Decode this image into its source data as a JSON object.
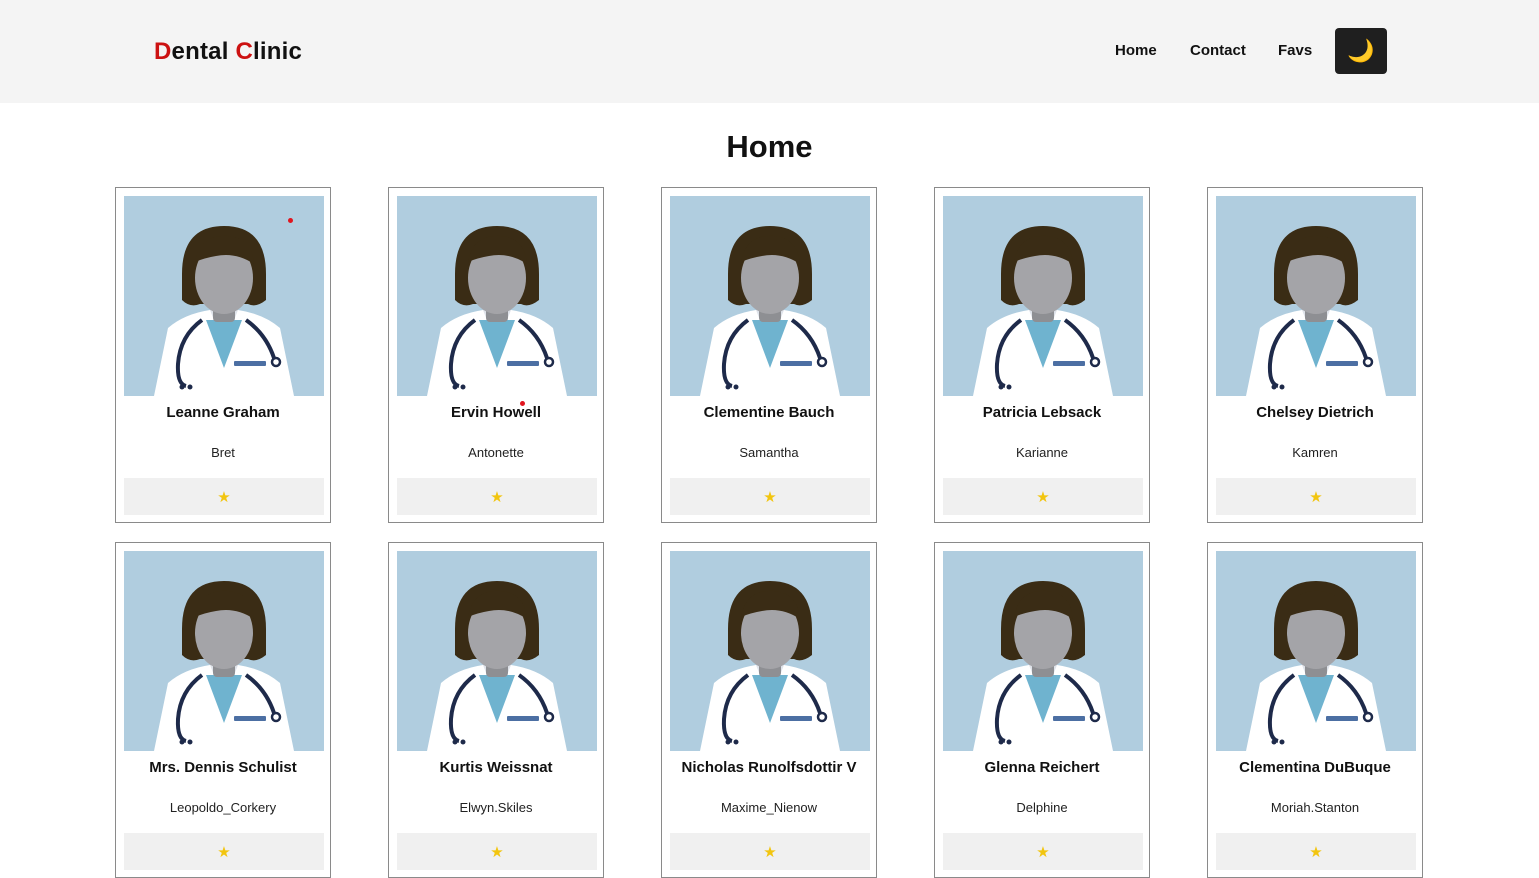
{
  "header": {
    "logo_first_initial": "D",
    "logo_first_rest": "ental ",
    "logo_second_initial": "C",
    "logo_second_rest": "linic",
    "nav": [
      {
        "label": "Home"
      },
      {
        "label": "Contact"
      },
      {
        "label": "Favs"
      }
    ],
    "theme_toggle_icon": "moon-icon",
    "theme_toggle_glyph": "🌙"
  },
  "main": {
    "title": "Home",
    "fav_glyph": "★",
    "fav_icon": "star-icon",
    "cards": [
      {
        "name": "Leanne Graham",
        "username": "Bret"
      },
      {
        "name": "Ervin Howell",
        "username": "Antonette"
      },
      {
        "name": "Clementine Bauch",
        "username": "Samantha"
      },
      {
        "name": "Patricia Lebsack",
        "username": "Karianne"
      },
      {
        "name": "Chelsey Dietrich",
        "username": "Kamren"
      },
      {
        "name": "Mrs. Dennis Schulist",
        "username": "Leopoldo_Corkery"
      },
      {
        "name": "Kurtis Weissnat",
        "username": "Elwyn.Skiles"
      },
      {
        "name": "Nicholas Runolfsdottir V",
        "username": "Maxime_Nienow"
      },
      {
        "name": "Glenna Reichert",
        "username": "Delphine"
      },
      {
        "name": "Clementina DuBuque",
        "username": "Moriah.Stanton"
      }
    ]
  },
  "colors": {
    "accent": "#cc1111",
    "navbar_bg": "#f4f4f4",
    "avatar_bg": "#b0cddf",
    "star": "#f2c50f",
    "theme_button_bg": "#1f1f1f"
  }
}
